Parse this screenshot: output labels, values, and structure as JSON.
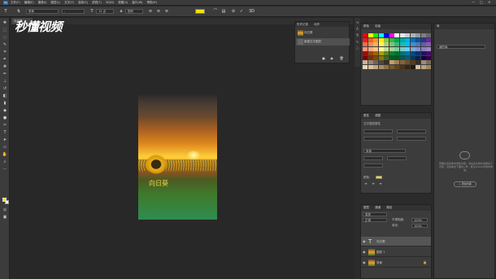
{
  "menubar": {
    "logo": "Ps",
    "items": [
      "文件(F)",
      "编辑(E)",
      "图像(I)",
      "图层(L)",
      "文字(Y)",
      "选择(S)",
      "滤镜(T)",
      "3D(D)",
      "视图(V)",
      "窗口(W)",
      "帮助(H)"
    ],
    "window_controls": [
      "—",
      "□",
      "✕"
    ]
  },
  "options_bar": {
    "font_family": "宋体",
    "font_style": "-",
    "font_size": "12 点",
    "aa_mode": "锐利",
    "text_color": "#f4e000"
  },
  "document_tab": {
    "label": "向日葵"
  },
  "watermark": {
    "text": "秒懂视频"
  },
  "canvas": {
    "caption": "向日葵"
  },
  "history": {
    "tabs": [
      "历史记录",
      "动作"
    ],
    "rows": [
      "向日葵",
      "新建文字图层"
    ]
  },
  "swatches_panel": {
    "tabs": [
      "颜色",
      "色板"
    ]
  },
  "properties_panel": {
    "tabs": [
      "属性",
      "调整"
    ],
    "title": "文字图层属性",
    "font": "宋体",
    "color_label": "颜色:",
    "color": "#f4e000"
  },
  "layers_panel": {
    "tabs": [
      "图层",
      "通道",
      "路径"
    ],
    "kind": "类型",
    "blend": "正常",
    "opacity_label": "不透明度:",
    "opacity": "100%",
    "fill_label": "填充:",
    "fill": "100%",
    "layers": [
      {
        "name": "向日葵",
        "type": "text"
      },
      {
        "name": "图层 1",
        "type": "image"
      },
      {
        "name": "背景",
        "type": "image"
      }
    ]
  },
  "libraries_panel": {
    "tabs": [
      "库"
    ],
    "library_select": "我的库",
    "message": "若要在您的库中添加内容，请在此文档中选择某个对象，然后单击下面的+号，或从Adobe市场中添加。",
    "button_label": "+ 添加内容"
  },
  "swatch_colors": [
    "#ff0000",
    "#ffff00",
    "#00ff00",
    "#00ffff",
    "#0000ff",
    "#ff00ff",
    "#ffffff",
    "#e6e6e6",
    "#cccccc",
    "#b3b3b3",
    "#999999",
    "#808080",
    "#666666",
    "#ed1c24",
    "#f26522",
    "#f7941d",
    "#fff200",
    "#8dc63f",
    "#39b54a",
    "#00a651",
    "#00a99d",
    "#00aeef",
    "#0072bc",
    "#0054a6",
    "#2e3192",
    "#662d91",
    "#f26c4f",
    "#f68e55",
    "#fbaf5c",
    "#fff467",
    "#acd372",
    "#7cc576",
    "#3bb878",
    "#1abbb4",
    "#00bff3",
    "#438ccb",
    "#5574b9",
    "#605ca8",
    "#855fa8",
    "#f7977a",
    "#f9ad81",
    "#fdc68a",
    "#fff79a",
    "#c4df9b",
    "#a3d39c",
    "#82ca9c",
    "#7accc8",
    "#6dcff6",
    "#7da7d9",
    "#8393ca",
    "#8781bd",
    "#a186be",
    "#9e0b0f",
    "#a0410d",
    "#a3620a",
    "#aba000",
    "#598527",
    "#1a7b30",
    "#007236",
    "#00746b",
    "#0076a3",
    "#004a80",
    "#003471",
    "#1b1464",
    "#440e62",
    "#790000",
    "#7b2e00",
    "#7d4900",
    "#827b00",
    "#406618",
    "#005e20",
    "#005826",
    "#005952",
    "#005b7f",
    "#003663",
    "#002157",
    "#0d004c",
    "#32004b",
    "#c7b299",
    "#998675",
    "#736357",
    "#534741",
    "#37302a",
    "#c69c6d",
    "#a67c52",
    "#8c6239",
    "#754c24",
    "#603913",
    "#3b2a1c",
    "#9f8b72",
    "#7a6a55",
    "#e8d5b5",
    "#d8c3a0",
    "#c2a97f",
    "#a98c5f",
    "#8e7044",
    "#75592f",
    "#5e4520",
    "#4a3416",
    "#37250e",
    "#251807",
    "#d2c0a0",
    "#b8a37e",
    "#9d875f"
  ]
}
